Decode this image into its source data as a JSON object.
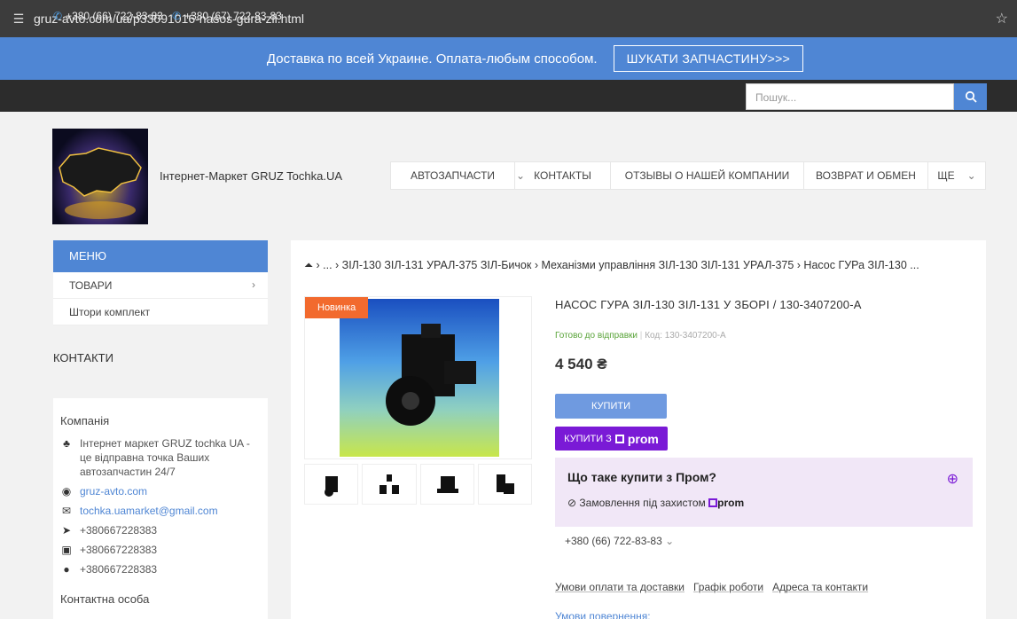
{
  "browser": {
    "url": "gruz-avto.com/ua/p33091016-nasos-gura-zil.html"
  },
  "promo": {
    "text": "Доставка по всей Украине. Оплата-любым способом.",
    "button": "ШУКАТИ ЗАПЧАСТИНУ>>>"
  },
  "topbar": {
    "phone1": "+380 (66) 722-83-83",
    "phone2": "+380 (67) 722-83-83",
    "search_placeholder": "Пошук..."
  },
  "header": {
    "shop_name": "Інтернет-Маркет GRUZ Tochka.UA",
    "nav": [
      "АВТОЗАПЧАСТИ",
      "КОНТАКТЫ",
      "ОТЗЫВЫ О НАШЕЙ КОМПАНИИ",
      "ВОЗВРАТ И ОБМЕН",
      "ЩЕ"
    ]
  },
  "sidebar": {
    "menu_title": "МЕНЮ",
    "items": [
      "ТОВАРИ",
      "Штори комплект"
    ],
    "contacts_title": "КОНТАКТИ",
    "company_label": "Компанія",
    "company_desc": "Інтернет маркет GRUZ tochka UA - це відправна точка Ваших автозапчастин 24/7",
    "site": "gruz-avto.com",
    "email": "tochka.uamarket@gmail.com",
    "telegram": "+380667228383",
    "viber": "+380667228383",
    "whatsapp": "+380667228383",
    "contact_person": "Контактна особа"
  },
  "breadcrumb": "› ... › ЗІЛ-130 ЗІЛ-131 УРАЛ-375 ЗІЛ-Бичок › Механізми управління ЗІЛ-130 ЗІЛ-131 УРАЛ-375 › Насос ГУРа ЗІЛ-130 ...",
  "product": {
    "badge": "Новинка",
    "title": "НАСОС ГУРА ЗІЛ-130 ЗІЛ-131 У ЗБОРІ / 130-3407200-А",
    "status": "Готово до відправки",
    "code": "Код: 130-3407200-А",
    "price": "4 540 ₴",
    "buy": "КУПИТИ",
    "buy_prom_prefix": "КУПИТИ З",
    "prom": "prom"
  },
  "prom_card": {
    "question": "Що таке купити з Пром?",
    "protection": "Замовлення під захистом"
  },
  "phone_select": "+380 (66) 722-83-83",
  "links": [
    "Умови оплати та доставки",
    "Графік роботи",
    "Адреса та контакти"
  ],
  "return_link": "Умови повернення:",
  "colors": {
    "accent": "#4f86d4",
    "prom": "#7a1ad6",
    "badge": "#f26a2e"
  }
}
